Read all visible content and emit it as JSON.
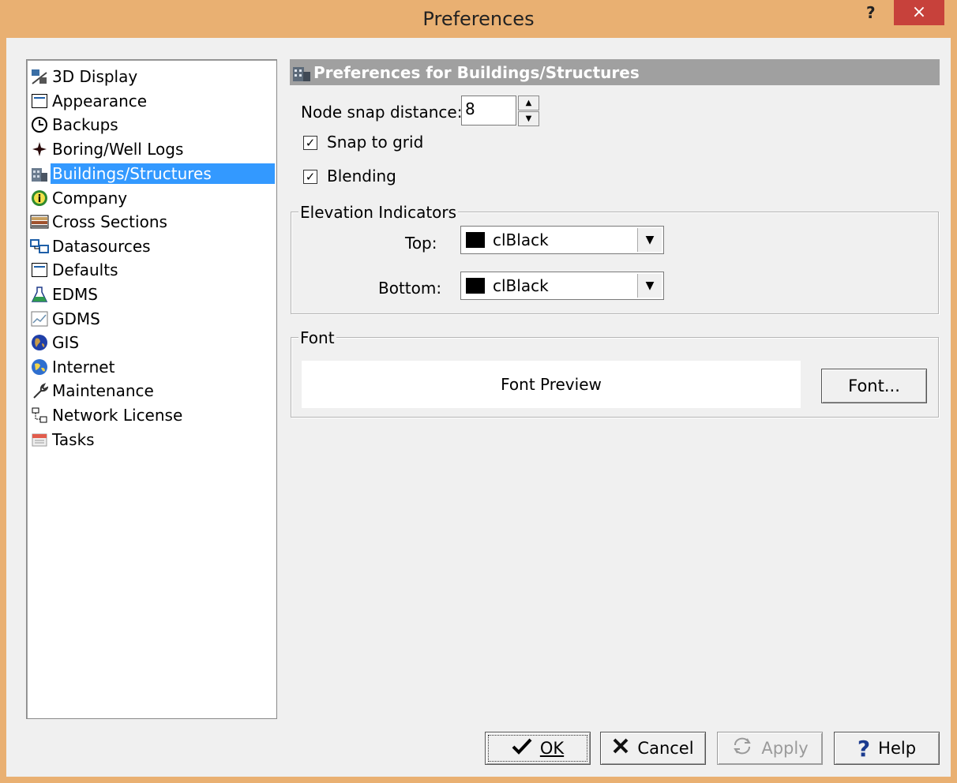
{
  "window": {
    "title": "Preferences",
    "help_glyph": "?",
    "close_glyph": "×"
  },
  "nav": {
    "items": [
      {
        "label": "3D Display",
        "icon": "3d-display-icon"
      },
      {
        "label": "Appearance",
        "icon": "appearance-icon"
      },
      {
        "label": "Backups",
        "icon": "clock-icon"
      },
      {
        "label": "Boring/Well Logs",
        "icon": "well-marker-icon"
      },
      {
        "label": "Buildings/Structures",
        "icon": "building-icon",
        "selected": true
      },
      {
        "label": "Company",
        "icon": "company-info-icon"
      },
      {
        "label": "Cross Sections",
        "icon": "cross-section-icon"
      },
      {
        "label": "Datasources",
        "icon": "datasource-icon"
      },
      {
        "label": "Defaults",
        "icon": "defaults-icon"
      },
      {
        "label": "EDMS",
        "icon": "flask-icon"
      },
      {
        "label": "GDMS",
        "icon": "chart-icon"
      },
      {
        "label": "GIS",
        "icon": "globe-icon"
      },
      {
        "label": "Internet",
        "icon": "internet-globe-icon"
      },
      {
        "label": "Maintenance",
        "icon": "wrench-icon"
      },
      {
        "label": "Network License",
        "icon": "network-icon"
      },
      {
        "label": "Tasks",
        "icon": "tasks-icon"
      }
    ]
  },
  "panel": {
    "header": "Preferences for Buildings/Structures",
    "node_snap_label": "Node snap distance:",
    "node_snap_value": "8",
    "snap_to_grid_label": "Snap to grid",
    "snap_to_grid_checked": true,
    "blending_label": "Blending",
    "blending_checked": true,
    "elevation_group": "Elevation Indicators",
    "top_label": "Top:",
    "top_value": "clBlack",
    "bottom_label": "Bottom:",
    "bottom_value": "clBlack",
    "swatch_color": "#000000",
    "font_group": "Font",
    "font_preview": "Font Preview",
    "font_button": "Font..."
  },
  "buttons": {
    "ok": "OK",
    "cancel": "Cancel",
    "apply": "Apply",
    "help": "Help"
  }
}
